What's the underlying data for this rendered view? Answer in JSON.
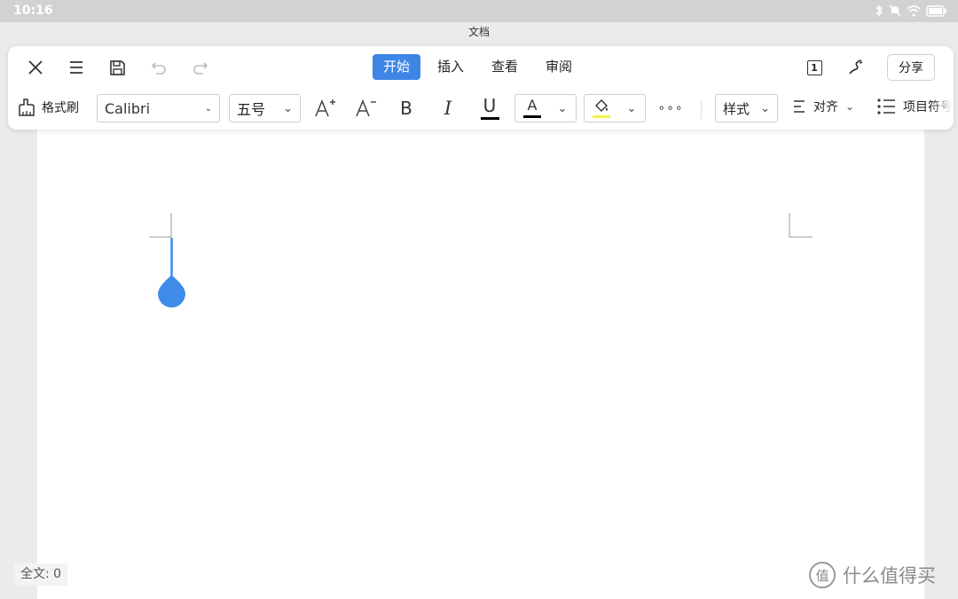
{
  "status_bar": {
    "time": "10:16"
  },
  "window": {
    "title": "文档"
  },
  "toolbar": {
    "tabs": [
      {
        "label": "开始",
        "active": true
      },
      {
        "label": "插入",
        "active": false
      },
      {
        "label": "查看",
        "active": false
      },
      {
        "label": "审阅",
        "active": false
      }
    ],
    "share_label": "分享",
    "page_indicator": "1",
    "format_painter_label": "格式刷",
    "font_name": "Calibri",
    "font_size": "五号",
    "bold_label": "B",
    "italic_label": "I",
    "underline_label": "U",
    "font_color_letter": "A",
    "more_label": "∘∘∘",
    "style_label": "样式",
    "align_label": "对齐",
    "list_label": "项目符号"
  },
  "colors": {
    "accent": "#3e86e6",
    "font_color": "#000000",
    "highlight_color": "#f5f24a",
    "cursor_handle": "#3f8be8"
  },
  "footer": {
    "word_count": "全文: 0",
    "watermark": "什么值得买",
    "watermark_logo": "值"
  }
}
